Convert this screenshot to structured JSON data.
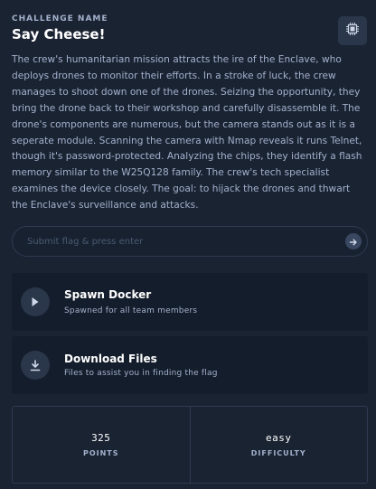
{
  "challenge": {
    "label": "CHALLENGE NAME",
    "name": "Say Cheese!",
    "description": "The crew's humanitarian mission attracts the ire of the Enclave, who deploys drones to monitor their efforts. In a stroke of luck, the crew manages to shoot down one of the drones. Seizing the opportunity, they bring the drone back to their workshop and carefully disassemble it. The drone's components are numerous, but the camera stands out as it is a seperate module. Scanning the camera with Nmap reveals it runs Telnet, though it's password-protected. Analyzing the chips, they identify a flash memory similar to the W25Q128 family. The crew's tech specialist examines the device closely. The goal: to hijack the drones and thwart the Enclave's surveillance and attacks."
  },
  "flag": {
    "placeholder": "Submit flag & press enter",
    "value": ""
  },
  "actions": {
    "spawn": {
      "title": "Spawn Docker",
      "subtitle": "Spawned for all team members",
      "icon": "play-icon"
    },
    "download": {
      "title": "Download Files",
      "subtitle": "Files to assist you in finding the flag",
      "icon": "download-icon"
    }
  },
  "stats": {
    "points_value": "325",
    "points_label": "POINTS",
    "difficulty_value": "easy",
    "difficulty_label": "DIFFICULTY"
  },
  "colors": {
    "background": "#1a2332",
    "card": "#141d2b",
    "text_primary": "#ffffff",
    "text_secondary": "#a4b1cd"
  }
}
